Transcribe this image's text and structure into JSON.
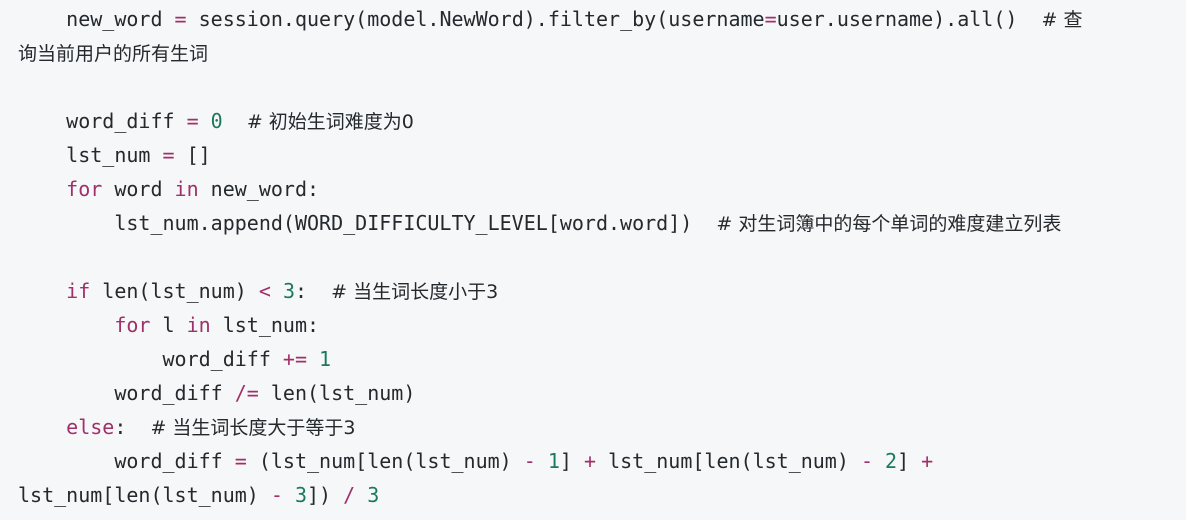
{
  "code": {
    "lines": [
      [
        {
          "t": "    new_word "
        },
        {
          "t": "=",
          "c": "op"
        },
        {
          "t": " session.query(model.NewWord).filter_by(username"
        },
        {
          "t": "=",
          "c": "op"
        },
        {
          "t": "user.username).all()  "
        },
        {
          "t": "# 查",
          "c": "cm"
        }
      ],
      [
        {
          "t": "询当前用户的所有生词",
          "c": "cm"
        }
      ],
      [],
      [
        {
          "t": "    word_diff "
        },
        {
          "t": "=",
          "c": "op"
        },
        {
          "t": " "
        },
        {
          "t": "0",
          "c": "num"
        },
        {
          "t": "  "
        },
        {
          "t": "# 初始生词难度为0",
          "c": "cm"
        }
      ],
      [
        {
          "t": "    lst_num "
        },
        {
          "t": "=",
          "c": "op"
        },
        {
          "t": " []"
        }
      ],
      [
        {
          "t": "    "
        },
        {
          "t": "for",
          "c": "kw"
        },
        {
          "t": " word "
        },
        {
          "t": "in",
          "c": "kw"
        },
        {
          "t": " new_word:"
        }
      ],
      [
        {
          "t": "        lst_num.append(WORD_DIFFICULTY_LEVEL[word.word])  "
        },
        {
          "t": "# 对生词簿中的每个单词的难度建立列表",
          "c": "cm"
        }
      ],
      [],
      [
        {
          "t": "    "
        },
        {
          "t": "if",
          "c": "kw"
        },
        {
          "t": " len(lst_num) "
        },
        {
          "t": "<",
          "c": "op"
        },
        {
          "t": " "
        },
        {
          "t": "3",
          "c": "num"
        },
        {
          "t": ":  "
        },
        {
          "t": "# 当生词长度小于3",
          "c": "cm"
        }
      ],
      [
        {
          "t": "        "
        },
        {
          "t": "for",
          "c": "kw"
        },
        {
          "t": " l "
        },
        {
          "t": "in",
          "c": "kw"
        },
        {
          "t": " lst_num:"
        }
      ],
      [
        {
          "t": "            word_diff "
        },
        {
          "t": "+=",
          "c": "op"
        },
        {
          "t": " "
        },
        {
          "t": "1",
          "c": "num"
        }
      ],
      [
        {
          "t": "        word_diff "
        },
        {
          "t": "/=",
          "c": "op"
        },
        {
          "t": " len(lst_num)"
        }
      ],
      [
        {
          "t": "    "
        },
        {
          "t": "else",
          "c": "kw"
        },
        {
          "t": ":  "
        },
        {
          "t": "# 当生词长度大于等于3",
          "c": "cm"
        }
      ],
      [
        {
          "t": "        word_diff "
        },
        {
          "t": "=",
          "c": "op"
        },
        {
          "t": " (lst_num[len(lst_num) "
        },
        {
          "t": "-",
          "c": "op"
        },
        {
          "t": " "
        },
        {
          "t": "1",
          "c": "num"
        },
        {
          "t": "] "
        },
        {
          "t": "+",
          "c": "op"
        },
        {
          "t": " lst_num[len(lst_num) "
        },
        {
          "t": "-",
          "c": "op"
        },
        {
          "t": " "
        },
        {
          "t": "2",
          "c": "num"
        },
        {
          "t": "] "
        },
        {
          "t": "+",
          "c": "op"
        }
      ],
      [
        {
          "t": "lst_num[len(lst_num) "
        },
        {
          "t": "-",
          "c": "op"
        },
        {
          "t": " "
        },
        {
          "t": "3",
          "c": "num"
        },
        {
          "t": "]) "
        },
        {
          "t": "/",
          "c": "op"
        },
        {
          "t": " "
        },
        {
          "t": "3",
          "c": "num"
        }
      ]
    ]
  }
}
